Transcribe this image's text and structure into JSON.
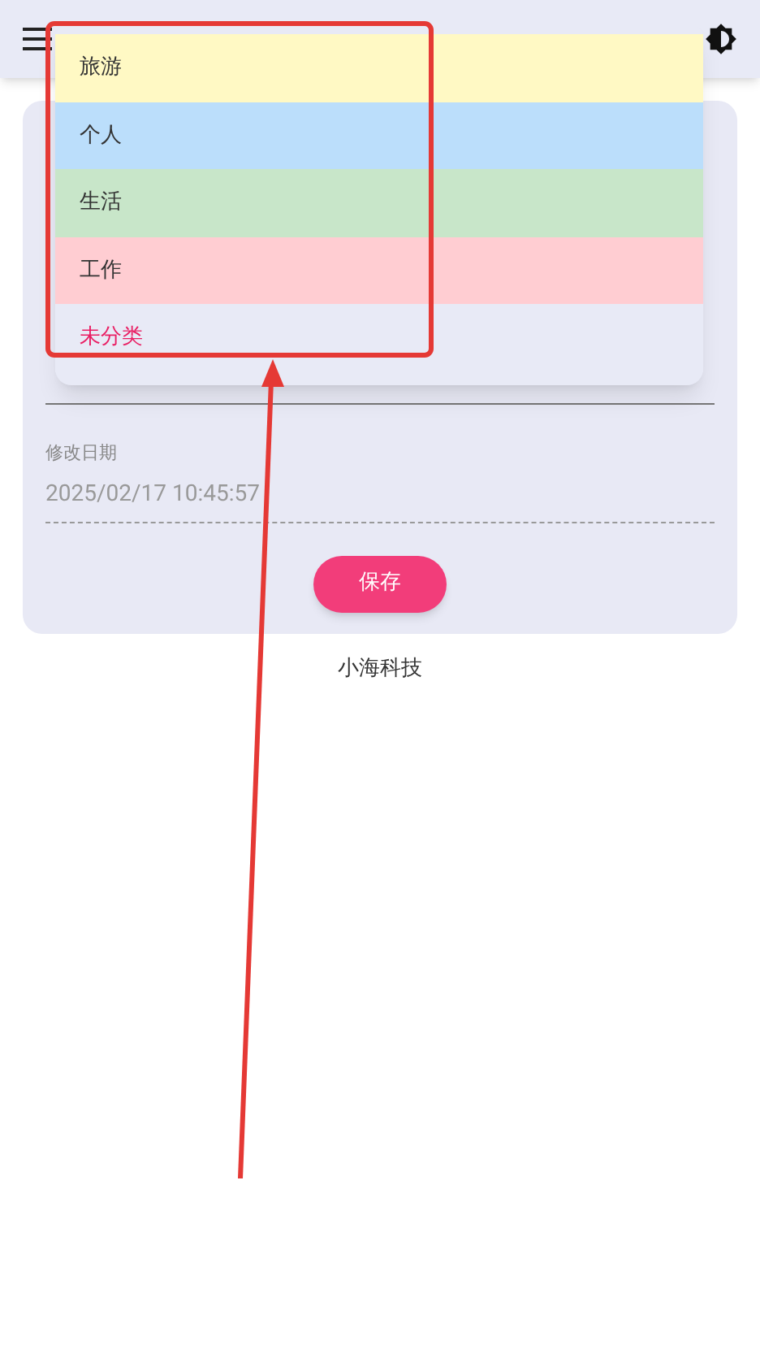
{
  "form": {
    "fields": [
      {
        "label": "修改日期",
        "value": "2025/02/17 10:45:57",
        "disabled": true
      }
    ],
    "save_button": "保存"
  },
  "footer": "小海科技",
  "dropdown": {
    "items": [
      {
        "label": "旅游",
        "color": "#fff9c4",
        "selected": false
      },
      {
        "label": "个人",
        "color": "#bbdefb",
        "selected": false
      },
      {
        "label": "生活",
        "color": "#c8e6c9",
        "selected": false
      },
      {
        "label": "工作",
        "color": "#ffcdd2",
        "selected": false
      },
      {
        "label": "未分类",
        "color": "#e8eaf6",
        "selected": true
      }
    ]
  }
}
